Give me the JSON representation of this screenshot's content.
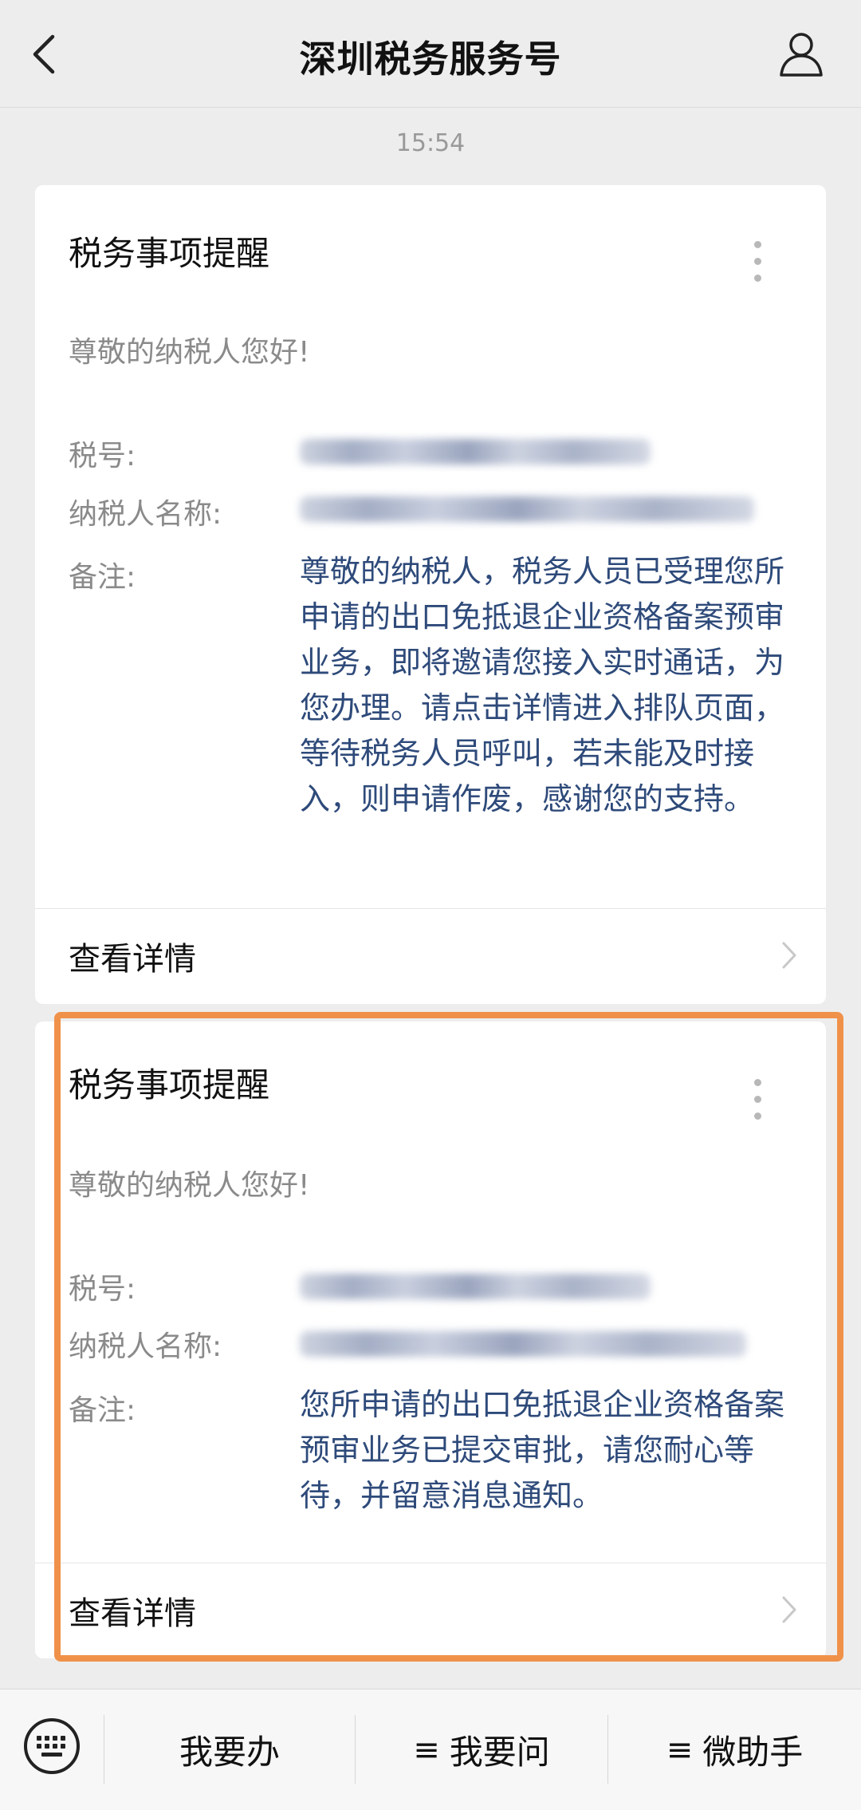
{
  "header": {
    "title": "深圳税务服务号"
  },
  "timestamp": "15:54",
  "cards": [
    {
      "title": "税务事项提醒",
      "greeting": "尊敬的纳税人您好!",
      "fields": {
        "tax_id_label": "税号:",
        "taxpayer_label": "纳税人名称:",
        "remark_label": "备注:"
      },
      "remark": "尊敬的纳税人，税务人员已受理您所申请的出口免抵退企业资格备案预审业务，即将邀请您接入实时通话，为您办理。请点击详情进入排队页面，等待税务人员呼叫，若未能及时接入，则申请作废，感谢您的支持。",
      "details_label": "查看详情"
    },
    {
      "title": "税务事项提醒",
      "greeting": "尊敬的纳税人您好!",
      "fields": {
        "tax_id_label": "税号:",
        "taxpayer_label": "纳税人名称:",
        "remark_label": "备注:"
      },
      "remark": "您所申请的出口免抵退企业资格备案预审业务已提交审批，请您耐心等待，并留意消息通知。",
      "details_label": "查看详情"
    }
  ],
  "bottom_menu": [
    {
      "label": "我要办"
    },
    {
      "icon": "≡",
      "label": "我要问"
    },
    {
      "icon": "≡",
      "label": "微助手"
    }
  ],
  "colors": {
    "highlight": "#f0914a",
    "remark_text": "#2e4a7a"
  }
}
